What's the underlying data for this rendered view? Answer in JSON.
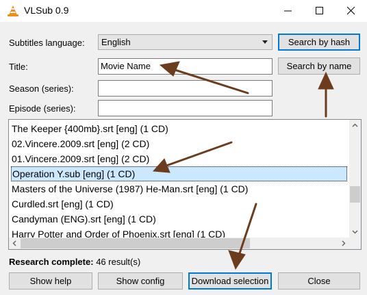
{
  "window": {
    "title": "VLSub 0.9",
    "icons": {
      "app": "vlc-cone-icon",
      "minimize": "minimize-icon",
      "maximize": "maximize-icon",
      "close": "close-icon"
    }
  },
  "form": {
    "language_label": "Subtitles language:",
    "language_value": "English",
    "title_label": "Title:",
    "title_value": "Movie Name",
    "season_label": "Season (series):",
    "season_value": "",
    "episode_label": "Episode (series):",
    "episode_value": ""
  },
  "buttons": {
    "search_hash": "Search by hash",
    "search_name": "Search by name",
    "show_help": "Show help",
    "show_config": "Show config",
    "download": "Download selection",
    "close": "Close"
  },
  "results": [
    "The Keeper {400mb}.srt [eng] (1 CD)",
    "02.Vincere.2009.srt [eng] (2 CD)",
    "01.Vincere.2009.srt [eng] (2 CD)",
    "Operation Y.sub [eng] (1 CD)",
    "Masters of the Universe (1987) He-Man.srt [eng] (1 CD)",
    "Curdled.srt [eng] (1 CD)",
    "Candyman (ENG).srt [eng] (1 CD)",
    "Harry Potter and Order of Phoenix.srt [eng] (1 CD)"
  ],
  "selected_result": "Operation Y.sub [eng] (1 CD)",
  "status": {
    "label": "Research complete:",
    "value": "46 result(s)"
  },
  "colors": {
    "selection": "#cce8ff",
    "focus_border": "#0078d7",
    "annotation_arrow": "#6b3d1e"
  }
}
